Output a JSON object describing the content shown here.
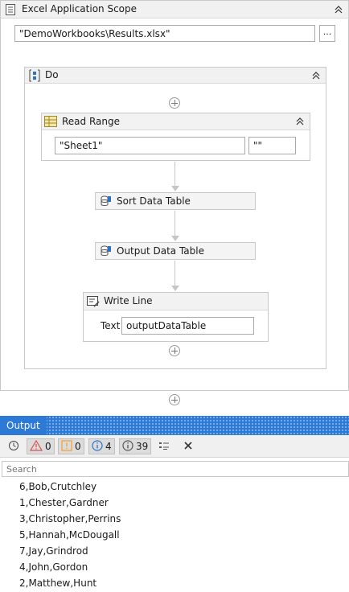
{
  "scope": {
    "title": "Excel Application Scope",
    "path_value": "\"DemoWorkbooks\\Results.xlsx\"",
    "browse_label": "..."
  },
  "do": {
    "title": "Do"
  },
  "read_range": {
    "title": "Read Range",
    "sheet_value": "\"Sheet1\"",
    "range_value": "\"\""
  },
  "sort": {
    "title": "Sort Data Table"
  },
  "output_dt": {
    "title": "Output Data Table"
  },
  "write_line": {
    "title": "Write Line",
    "text_label": "Text",
    "text_value": "outputDataTable"
  },
  "output_panel": {
    "title": "Output",
    "errors": "0",
    "warnings": "0",
    "info": "4",
    "trace": "39",
    "search_placeholder": "Search",
    "lines": [
      "6,Bob,Crutchley",
      "1,Chester,Gardner",
      "3,Christopher,Perrins",
      "5,Hannah,McDougall",
      "7,Jay,Grindrod",
      "4,John,Gordon",
      "2,Matthew,Hunt"
    ]
  },
  "colors": {
    "accent": "#1e6fc9",
    "error": "#d9534f",
    "warning": "#f0a030",
    "info": "#2a72c9"
  }
}
